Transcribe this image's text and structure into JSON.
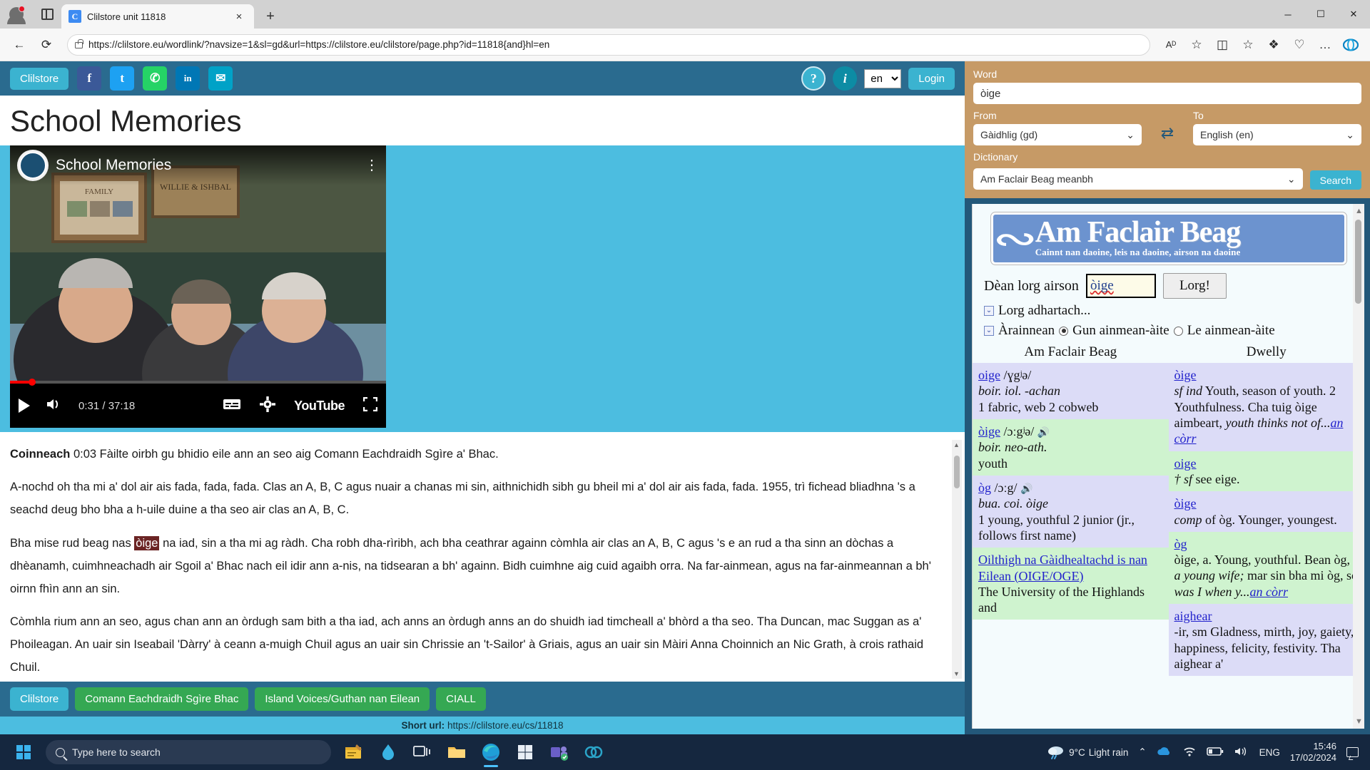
{
  "browser": {
    "tab_title": "Clilstore unit 11818",
    "tab_favicon_letter": "C",
    "new_tab_label": "+",
    "close_tab_label": "×",
    "win_minimize": "─",
    "win_maximize": "☐",
    "win_close": "✕",
    "back_label": "←",
    "refresh_label": "⟳",
    "url": "https://clilstore.eu/wordlink/?navsize=1&sl=gd&url=https://clilstore.eu/clilstore/page.php?id=11818{and}hl=en",
    "url_domain": "https://clilstore.eu",
    "url_rest": "/wordlink/?navsize=1&sl=gd&url=https://clilstore.eu/clilstore/page.php?id=11818{and}hl=en",
    "read_aloud": "Aᴰ",
    "favorite": "☆",
    "split_screen": "◫",
    "collections": "❖",
    "browser_essentials": "♡",
    "settings_more": "…"
  },
  "clilstore_header": {
    "brand_button": "Clilstore",
    "social": [
      {
        "name": "facebook-icon",
        "glyph": "f"
      },
      {
        "name": "twitter-icon",
        "glyph": "t"
      },
      {
        "name": "whatsapp-icon",
        "glyph": "✆"
      },
      {
        "name": "linkedin-icon",
        "glyph": "in"
      },
      {
        "name": "email-icon",
        "glyph": "✉"
      }
    ],
    "help_label": "?",
    "info_label": "i",
    "language_value": "en",
    "login_label": "Login"
  },
  "main": {
    "page_title": "School Memories",
    "video": {
      "title": "School Memories",
      "time_current": "0:31",
      "time_total": "37:18",
      "time_display": "0:31 / 37:18",
      "youtube_label": "YouTube",
      "menu_glyph": "⋮"
    },
    "transcript": [
      {
        "speaker": "Coinneach",
        "timestamp": "0:03",
        "text": "Fàilte oirbh gu bhidio eile ann an seo aig Comann Eachdraidh Sgìre a' Bhac."
      },
      {
        "speaker": "",
        "timestamp": "",
        "text": "A-nochd oh tha mi a' dol air ais fada, fada, fada. Clas an A, B, C agus nuair a chanas mi sin, aithnichidh sibh gu bheil mi a' dol air ais fada, fada. 1955, trì fichead bliadhna 's a seachd deug bho bha a h-uile duine a tha seo air clas an A, B, C."
      },
      {
        "speaker": "",
        "timestamp": "",
        "text_before": "Bha mise rud beag nas ",
        "highlight": "òige",
        "text_after": " na iad, sin a tha mi ag ràdh. Cha robh dha-rìribh, ach bha ceathrar againn còmhla air clas an A, B, C agus 's e an rud a tha sinn an dòchas a dhèanamh, cuimhneachadh air Sgoil a' Bhac nach eil idir ann a-nis, na tidsearan a bh' againn. Bidh cuimhne aig cuid agaibh orra. Na far-ainmean, agus na far-ainmeannan a bh' oirnn fhìn ann an sin."
      },
      {
        "speaker": "",
        "timestamp": "",
        "text": "Còmhla rium ann an seo, agus chan ann an òrdugh sam bith a tha iad, ach anns an òrdugh anns an do shuidh iad timcheall a' bhòrd a tha seo. Tha Duncan, mac Suggan as a' Phoileagan. An uair sin Iseabail 'Dàrry' à ceann a-muigh Chuil agus an uair sin Chrissie an 't-Sailor' à Griais, agus an uair sin Màiri Anna Choinnich an Nic Grath, à crois rathaid Chuil."
      }
    ],
    "footer_buttons": [
      {
        "label": "Clilstore",
        "style": "blue"
      },
      {
        "label": "Comann Eachdraidh Sgìre Bhac",
        "style": "green"
      },
      {
        "label": "Island Voices/Guthan nan Eilean",
        "style": "green"
      },
      {
        "label": "CIALL",
        "style": "green"
      }
    ],
    "short_url_label": "Short url:",
    "short_url_value": "https://clilstore.eu/cs/11818"
  },
  "sidebar": {
    "word_label": "Word",
    "word_value": "òige",
    "from_label": "From",
    "from_value": "Gàidhlig (gd)",
    "to_label": "To",
    "to_value": "English (en)",
    "swap_icon": "⇄",
    "dictionary_label": "Dictionary",
    "dictionary_value": "Am Faclair Beag meanbh",
    "search_button": "Search",
    "afb": {
      "logo_main": "Am Faclair Beag",
      "logo_sub": "Cainnt nan daoine, leis na daoine, airson na daoine",
      "search_label": "Dèan lorg airson",
      "search_value": "òige",
      "search_button": "Lorg!",
      "advanced_label": "Lorg adhartach...",
      "scope_label": "Àrainnean",
      "radio_no_placenames": "Gun ainmean-àite",
      "radio_with_placenames": "Le ainmean-àite",
      "column_left_header": "Am Faclair Beag",
      "column_right_header": "Dwelly",
      "left_entries": [
        {
          "headword": "oige",
          "ipa": "/ɣgʲə/",
          "audio": false,
          "gram": "boir. iol. -achan",
          "def": "1 fabric, web 2 cobweb",
          "bg": "violet"
        },
        {
          "headword": "òige",
          "ipa": "/ɔːgʲə/",
          "audio": true,
          "gram": "boir. neo-ath.",
          "def": "youth",
          "bg": "green"
        },
        {
          "headword": "òg",
          "ipa": "/ɔːg/",
          "audio": true,
          "gram": "bua. coi. òige",
          "def": "1 young, youthful 2 junior (jr., follows first name)",
          "bg": "violet"
        },
        {
          "headword": "Oilthigh na Gàidhealtachd is nan Eilean (OIGE/OGE)",
          "ipa": "",
          "audio": false,
          "gram": "",
          "def": "The University of the Highlands and",
          "bg": "green"
        }
      ],
      "right_entries": [
        {
          "headword": "òige",
          "gram": "sf ind",
          "def": "Youth, season of youth. 2 Youthfulness. Cha tuig òige aimbeart,",
          "def_italic": "youth thinks not of...",
          "more_link": "an còrr",
          "bg": "violet"
        },
        {
          "headword": "oige",
          "gram": "† sf",
          "def": "see eige.",
          "def_italic": "",
          "more_link": "",
          "bg": "green"
        },
        {
          "headword": "òige",
          "gram": "comp",
          "def": "of òg. Younger, youngest.",
          "def_italic": "",
          "more_link": "",
          "bg": "violet"
        },
        {
          "headword": "òg",
          "gram": "òige, a.",
          "def": "Young, youthful. Bean òg,",
          "def_italic": "a young wife;",
          "def_tail": " mar sin bha mi òg, so ",
          "def_italic2": "was I when y...",
          "more_link": "an còrr",
          "bg": "green"
        },
        {
          "headword": "aighear",
          "gram": "-ir, sm",
          "def": "Gladness, mirth, joy, gaiety, happiness, felicity, festivity. Tha aighear a'",
          "def_italic": "",
          "more_link": "",
          "bg": "violet"
        }
      ]
    }
  },
  "taskbar": {
    "search_placeholder": "Type here to search",
    "weather_temp": "9°C",
    "weather_desc": "Light rain",
    "language": "ENG",
    "time": "15:46",
    "date": "17/02/2024"
  },
  "colors": {
    "clilstore_header": "#2a6b8f",
    "accent_cyan": "#3bb3d0",
    "video_bg": "#4cbde0",
    "sidebar_form": "#c69a66",
    "sidebar_bg": "#23587a",
    "highlight_word": "#6b2424",
    "entry_violet": "#dcdcf7",
    "entry_green": "#cff3cf",
    "footer_green": "#35a853"
  }
}
